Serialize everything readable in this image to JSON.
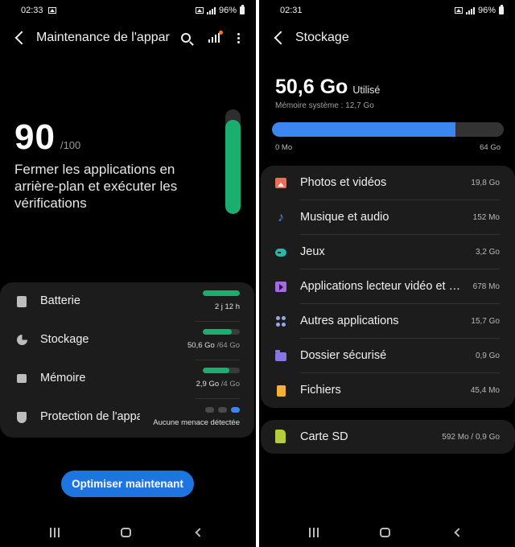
{
  "left": {
    "status": {
      "time": "02:33",
      "battery": "96%"
    },
    "appbar": {
      "title": "Maintenance de l'appareil"
    },
    "score": {
      "value": "90",
      "max": "/100",
      "level": 0.9
    },
    "description": "Fermer les applications en arrière-plan et exécuter les vérifications",
    "metrics": [
      {
        "label": "Batterie",
        "value": "2 j 12 h",
        "sub": "",
        "fill": 1.0,
        "icon": "battery-icon"
      },
      {
        "label": "Stockage",
        "value": "50,6 Go",
        "sub": " /64 Go",
        "fill": 0.79,
        "icon": "storage-pie-icon"
      },
      {
        "label": "Mémoire",
        "value": "2,9 Go",
        "sub": " /4 Go",
        "fill": 0.72,
        "icon": "memory-chip-icon"
      },
      {
        "label": "Protection de l'appareil",
        "value": "Aucune menace détectée",
        "sub": "",
        "icon": "shield-icon",
        "security_dots": 3,
        "active_dot": 3
      }
    ],
    "cta": "Optimiser maintenant"
  },
  "right": {
    "status": {
      "time": "02:31",
      "battery": "96%"
    },
    "appbar": {
      "title": "Stockage"
    },
    "used": {
      "value": "50,6 Go",
      "label": "Utilisé"
    },
    "system_memory": "Mémoire système : 12,7 Go",
    "bar": {
      "used_gb": 50.6,
      "total_gb": 64,
      "min_label": "0 Mo",
      "max_label": "64 Go",
      "color": "#3b86f1"
    },
    "categories": [
      {
        "label": "Photos et vidéos",
        "size": "19,8 Go",
        "icon": "photo-icon",
        "color": "#ef6b5a"
      },
      {
        "label": "Musique et audio",
        "size": "152 Mo",
        "icon": "music-note-icon",
        "color": "#4c8df0"
      },
      {
        "label": "Jeux",
        "size": "3,2 Go",
        "icon": "gamepad-icon",
        "color": "#2bb5a4"
      },
      {
        "label": "Applications lecteur vidéo et audio",
        "size": "678 Mo",
        "icon": "video-player-icon",
        "color": "#a768e8"
      },
      {
        "label": "Autres applications",
        "size": "15,7 Go",
        "icon": "apps-grid-icon",
        "color": "#9aa7e6"
      },
      {
        "label": "Dossier sécurisé",
        "size": "0,9 Go",
        "icon": "secure-folder-icon",
        "color": "#8577e3"
      },
      {
        "label": "Fichiers",
        "size": "45,4 Mo",
        "icon": "file-icon",
        "color": "#f3b13c"
      }
    ],
    "sd_card": {
      "label": "Carte SD",
      "size": "592 Mo / 0,9 Go",
      "icon": "sd-card-icon",
      "color": "#b6cc3c"
    }
  },
  "colors": {
    "accent_green": "#1aae6f",
    "accent_blue": "#1f75e0",
    "background": "#000000",
    "card": "#1c1c1c"
  }
}
